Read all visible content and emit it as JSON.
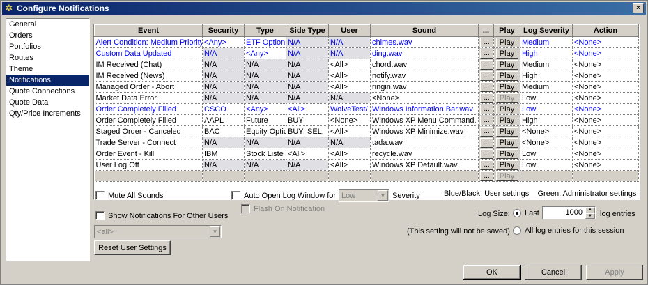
{
  "window": {
    "title": "Configure Notifications",
    "close_label": "×"
  },
  "sidebar": {
    "items": [
      {
        "label": "General",
        "selected": false
      },
      {
        "label": "Orders",
        "selected": false
      },
      {
        "label": "Portfolios",
        "selected": false
      },
      {
        "label": "Routes",
        "selected": false
      },
      {
        "label": "Theme",
        "selected": false
      },
      {
        "label": "Notifications",
        "selected": true
      },
      {
        "label": "Quote Connections",
        "selected": false
      },
      {
        "label": "Quote Data",
        "selected": false
      },
      {
        "label": "Qty/Price Increments",
        "selected": false
      }
    ]
  },
  "grid": {
    "columns": [
      "Event",
      "Security",
      "Type",
      "Side Type",
      "User",
      "Sound",
      "...",
      "Play",
      "Log Severity",
      "Action"
    ],
    "dots_label": "...",
    "play_label": "Play",
    "rows": [
      {
        "event": "Alert Condition: Medium Priority",
        "security": "<Any>",
        "type": "ETF Option",
        "side": "N/A",
        "user": "N/A",
        "sound": "chimes.wav",
        "severity": "Medium",
        "action": "<None>",
        "blue": true,
        "play_enabled": true
      },
      {
        "event": "Custom Data Updated",
        "security": "N/A",
        "type": "<Any>",
        "side": "N/A",
        "user": "N/A",
        "sound": "ding.wav",
        "severity": "High",
        "action": "<None>",
        "blue": true,
        "play_enabled": true
      },
      {
        "event": "IM Received (Chat)",
        "security": "N/A",
        "type": "N/A",
        "side": "N/A",
        "user": "<All>",
        "sound": "chord.wav",
        "severity": "Medium",
        "action": "<None>",
        "blue": false,
        "play_enabled": true
      },
      {
        "event": "IM Received (News)",
        "security": "N/A",
        "type": "N/A",
        "side": "N/A",
        "user": "<All>",
        "sound": "notify.wav",
        "severity": "High",
        "action": "<None>",
        "blue": false,
        "play_enabled": true
      },
      {
        "event": "Managed Order - Abort",
        "security": "N/A",
        "type": "N/A",
        "side": "N/A",
        "user": "<All>",
        "sound": "ringin.wav",
        "severity": "Medium",
        "action": "<None>",
        "blue": false,
        "play_enabled": true
      },
      {
        "event": "Market Data Error",
        "security": "N/A",
        "type": "N/A",
        "side": "N/A",
        "user": "N/A",
        "sound": "<None>",
        "severity": "Low",
        "action": "<None>",
        "blue": false,
        "play_enabled": false
      },
      {
        "event": "Order Completely Filled",
        "security": "CSCO",
        "type": "<Any>",
        "side": "<All>",
        "user": "WolveTest/",
        "sound": "Windows Information Bar.wav",
        "severity": "Low",
        "action": "<None>",
        "blue": true,
        "play_enabled": true
      },
      {
        "event": "Order Completely Filled",
        "security": "AAPL",
        "type": "Future",
        "side": "BUY",
        "user": "<None>",
        "sound": "Windows XP Menu Command.",
        "severity": "High",
        "action": "<None>",
        "blue": false,
        "play_enabled": true
      },
      {
        "event": "Staged Order - Canceled",
        "security": "BAC",
        "type": "Equity Optio",
        "side": "BUY; SEL;",
        "user": "<All>",
        "sound": "Windows XP Minimize.wav",
        "severity": "<None>",
        "action": "<None>",
        "blue": false,
        "play_enabled": true
      },
      {
        "event": "Trade Server - Connect",
        "security": "N/A",
        "type": "N/A",
        "side": "N/A",
        "user": "N/A",
        "sound": "tada.wav",
        "severity": "<None>",
        "action": "<None>",
        "blue": false,
        "play_enabled": true
      },
      {
        "event": "Order Event - Kill",
        "security": "IBM",
        "type": "Stock Liste",
        "side": "<All>",
        "user": "<All>",
        "sound": "recycle.wav",
        "severity": "Low",
        "action": "<None>",
        "blue": false,
        "play_enabled": true
      },
      {
        "event": "User Log Off",
        "security": "N/A",
        "type": "N/A",
        "side": "N/A",
        "user": "<All>",
        "sound": "Windows XP Default.wav",
        "severity": "Low",
        "action": "<None>",
        "blue": false,
        "play_enabled": true
      }
    ]
  },
  "options": {
    "mute_all": "Mute All Sounds",
    "show_other_users": "Show Notifications For Other Users",
    "user_combo_value": "<all>",
    "reset_button": "Reset User Settings",
    "auto_open_log": "Auto Open Log Window for",
    "auto_open_severity": "Low",
    "severity_label": "Severity",
    "flash_on_notification": "Flash On Notification",
    "legend_text": "Blue/Black: User settings    Green: Administrator settings",
    "log_size_label": "Log Size:",
    "last_label": "Last",
    "log_size_value": "1000",
    "log_entries_label": "log entries",
    "not_saved_note": "(This setting will not be saved)",
    "all_entries_label": "All log entries for this session"
  },
  "footer": {
    "ok": "OK",
    "cancel": "Cancel",
    "apply": "Apply"
  },
  "colors": {
    "user_setting": "#0000ff",
    "title_bar": "#0a246a",
    "selection": "#0a246a"
  },
  "icons": {
    "title": "gear-icon",
    "close": "close-icon",
    "dropdown": "chevron-down-icon"
  }
}
